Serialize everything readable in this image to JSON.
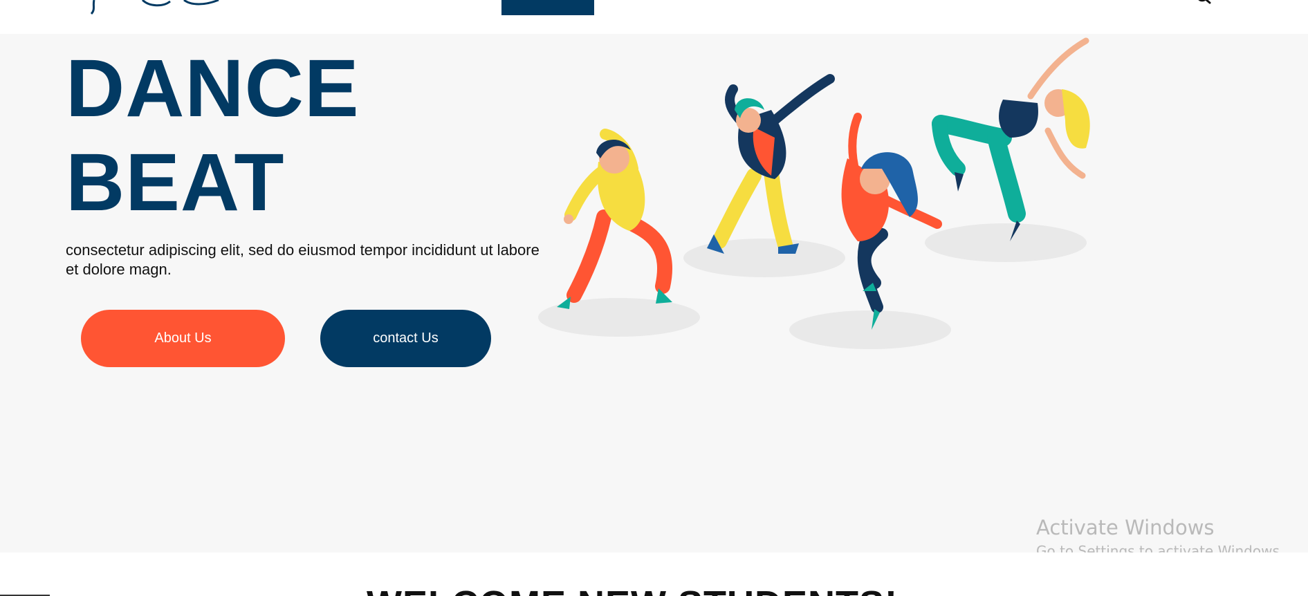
{
  "hero": {
    "title_line1": "DANCE",
    "title_line2": "BEAT",
    "description": "consectetur adipiscing elit, sed do eiusmod tempor incididunt ut labore et dolore magn.",
    "about_button": "About Us",
    "contact_button": "contact Us"
  },
  "section": {
    "heading": "WELCOME NEW STUDENTS!"
  },
  "watermark": {
    "title": "Activate Windows",
    "subtitle": "Go to Settings to activate Windows."
  },
  "colors": {
    "primary": "#023a63",
    "accent": "#ff5533",
    "hero_bg": "#f7f7f7"
  }
}
